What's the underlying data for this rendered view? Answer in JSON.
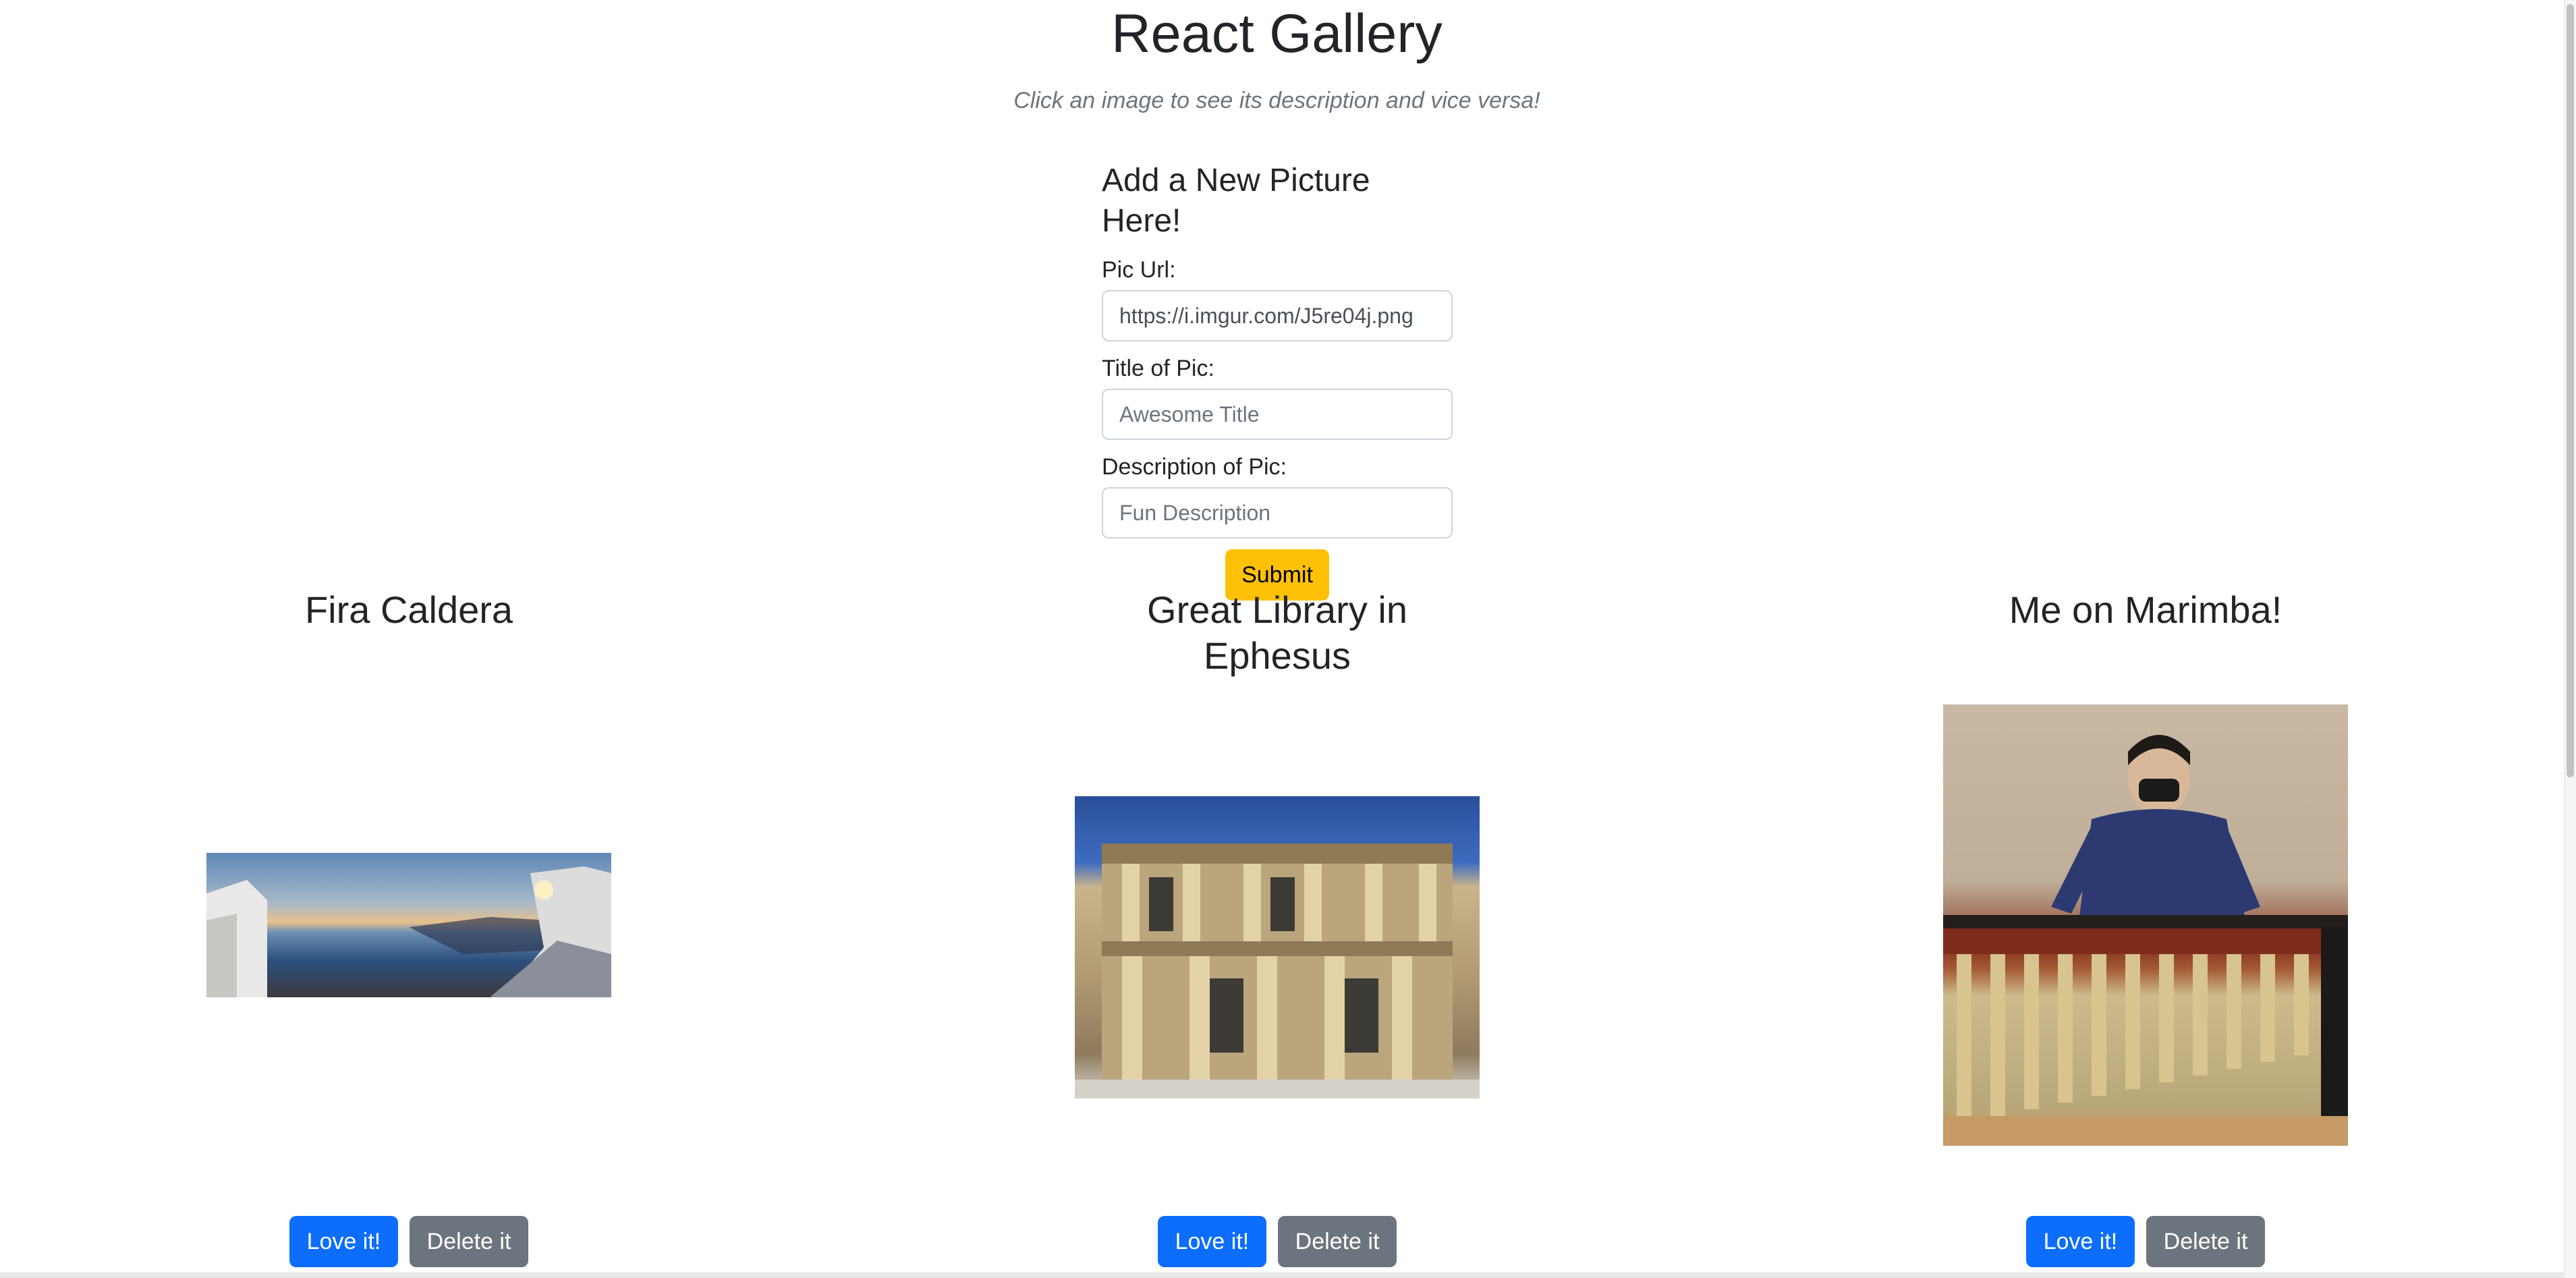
{
  "header": {
    "title": "React Gallery",
    "subtitle": "Click an image to see its description and vice versa!"
  },
  "form": {
    "heading": "Add a New Picture Here!",
    "url_label": "Pic Url:",
    "url_value": "https://i.imgur.com/J5re04j.png",
    "title_label": "Title of Pic:",
    "title_placeholder": "Awesome Title",
    "description_label": "Description of Pic:",
    "description_placeholder": "Fun Description",
    "submit_label": "Submit"
  },
  "gallery": [
    {
      "title": "Fira Caldera",
      "love_label": "Love it!",
      "delete_label": "Delete it"
    },
    {
      "title": "Great Library in Ephesus",
      "love_label": "Love it!",
      "delete_label": "Delete it"
    },
    {
      "title": "Me on Marimba!",
      "love_label": "Love it!",
      "delete_label": "Delete it"
    }
  ],
  "colors": {
    "primary": "#0d6efd",
    "secondary": "#6c757d",
    "warning": "#ffc107"
  }
}
